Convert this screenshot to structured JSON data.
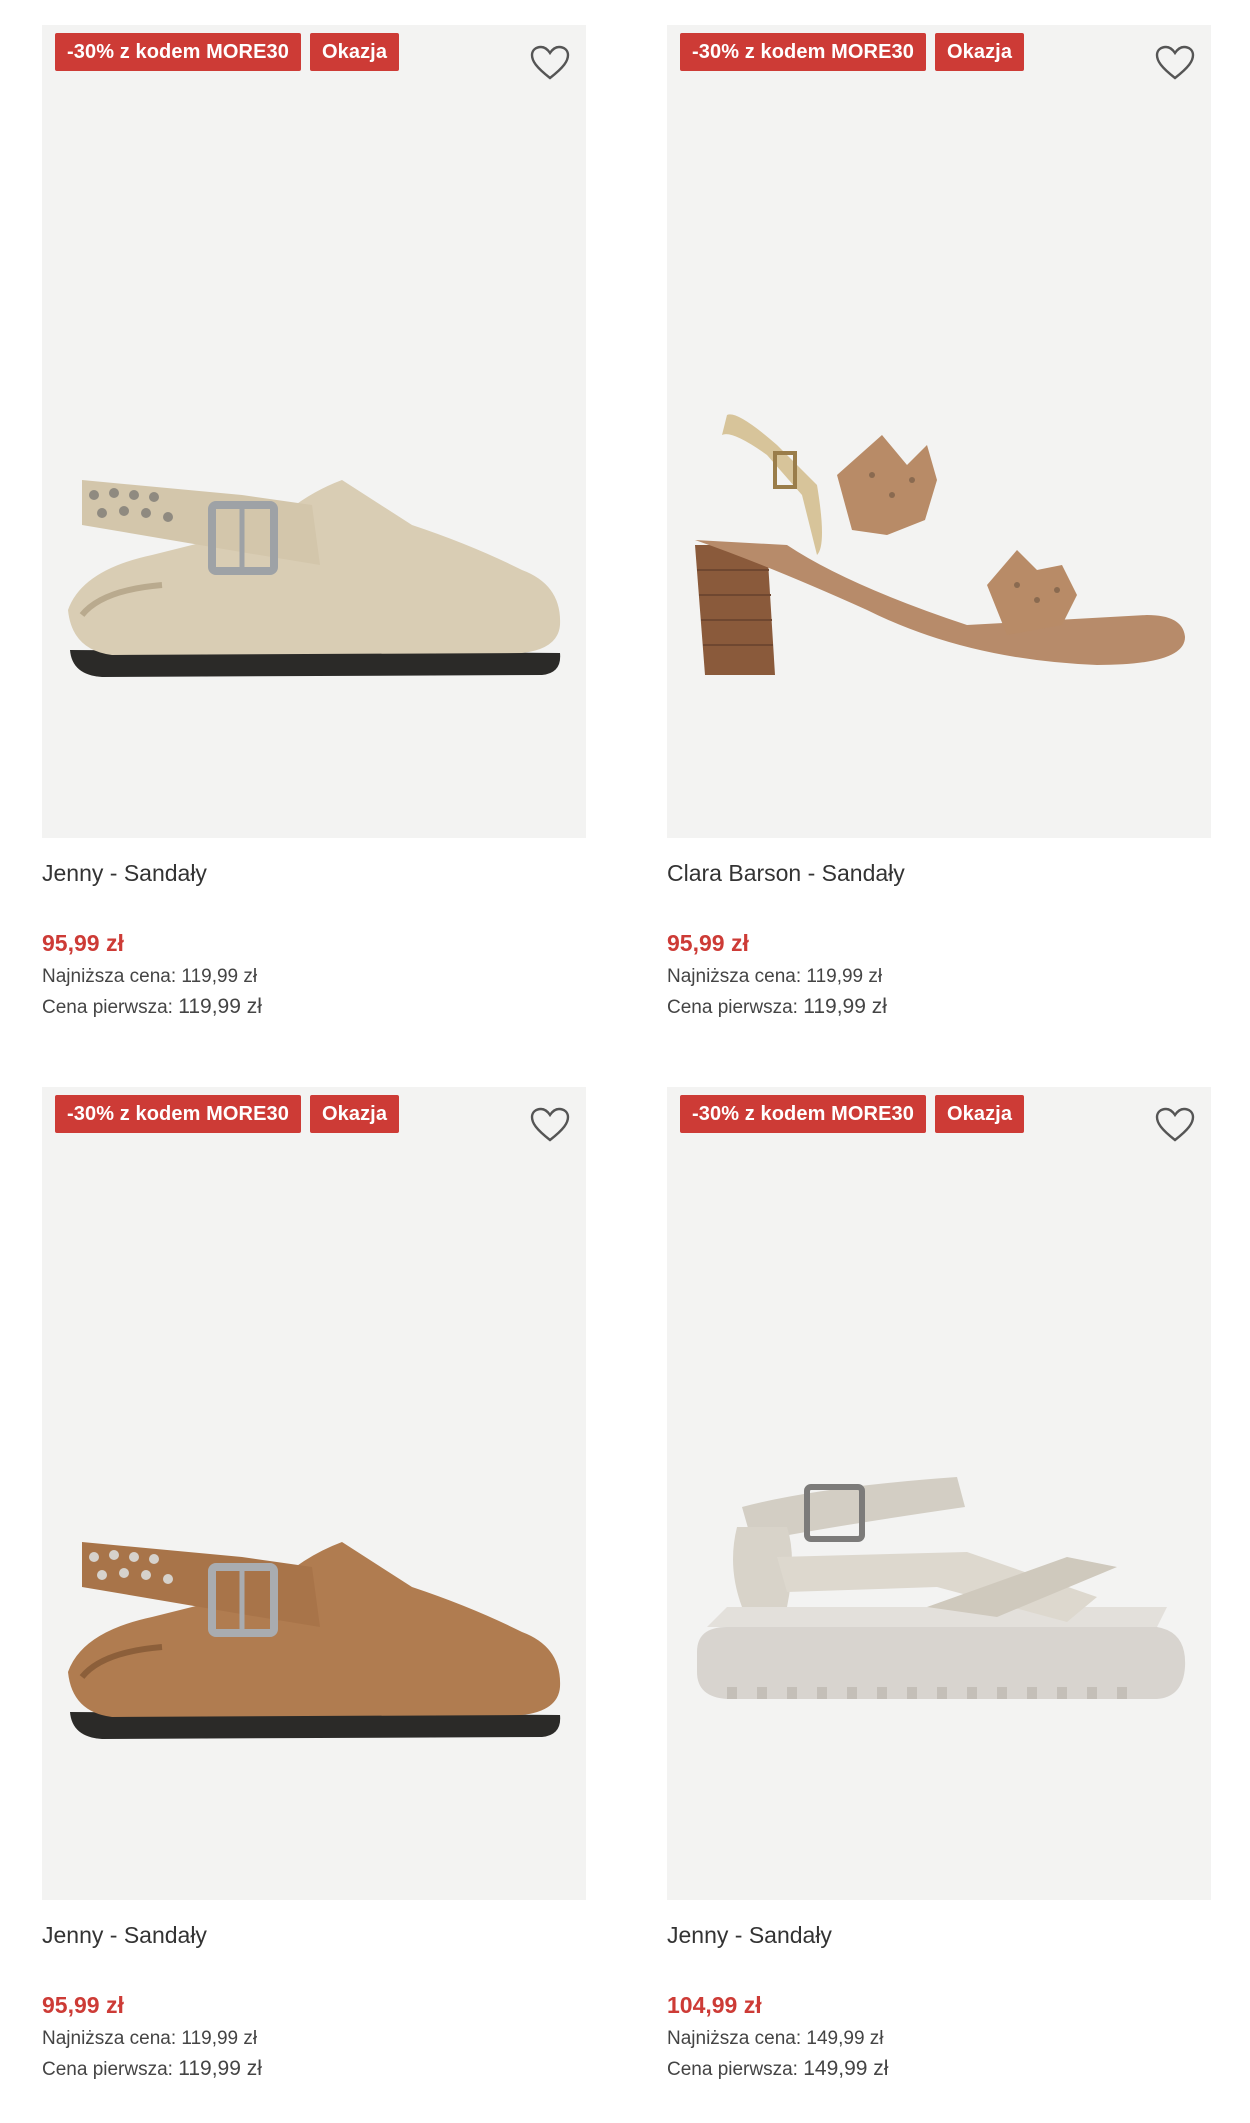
{
  "products": [
    {
      "badge_promo": "-30% z kodem MORE30",
      "badge_deal": "Okazja",
      "name": "Jenny - Sandały",
      "price": "95,99 zł",
      "lowest_label": "Najniższa cena:",
      "lowest_value": "119,99 zł",
      "first_label": "Cena pierwsza:",
      "first_value": "119,99 zł",
      "image": "beige-suede-clog-slingback"
    },
    {
      "badge_promo": "-30% z kodem MORE30",
      "badge_deal": "Okazja",
      "name": "Clara Barson - Sandały",
      "price": "95,99 zł",
      "lowest_label": "Najniższa cena:",
      "lowest_value": "119,99 zł",
      "first_label": "Cena pierwsza:",
      "first_value": "119,99 zł",
      "image": "tan-block-heel-sandal"
    },
    {
      "badge_promo": "-30% z kodem MORE30",
      "badge_deal": "Okazja",
      "name": "Jenny - Sandały",
      "price": "95,99 zł",
      "lowest_label": "Najniższa cena:",
      "lowest_value": "119,99 zł",
      "first_label": "Cena pierwsza:",
      "first_value": "119,99 zł",
      "image": "brown-suede-clog-slingback"
    },
    {
      "badge_promo": "-30% z kodem MORE30",
      "badge_deal": "Okazja",
      "name": "Jenny - Sandały",
      "price": "104,99 zł",
      "lowest_label": "Najniższa cena:",
      "lowest_value": "149,99 zł",
      "first_label": "Cena pierwsza:",
      "first_value": "149,99 zł",
      "image": "grey-platform-sandal"
    }
  ],
  "colors": {
    "badge": "#cd3b36",
    "price": "#cd3b36",
    "image_bg": "#f3f3f2"
  },
  "icons": {
    "favorite": "heart-outline-icon"
  }
}
